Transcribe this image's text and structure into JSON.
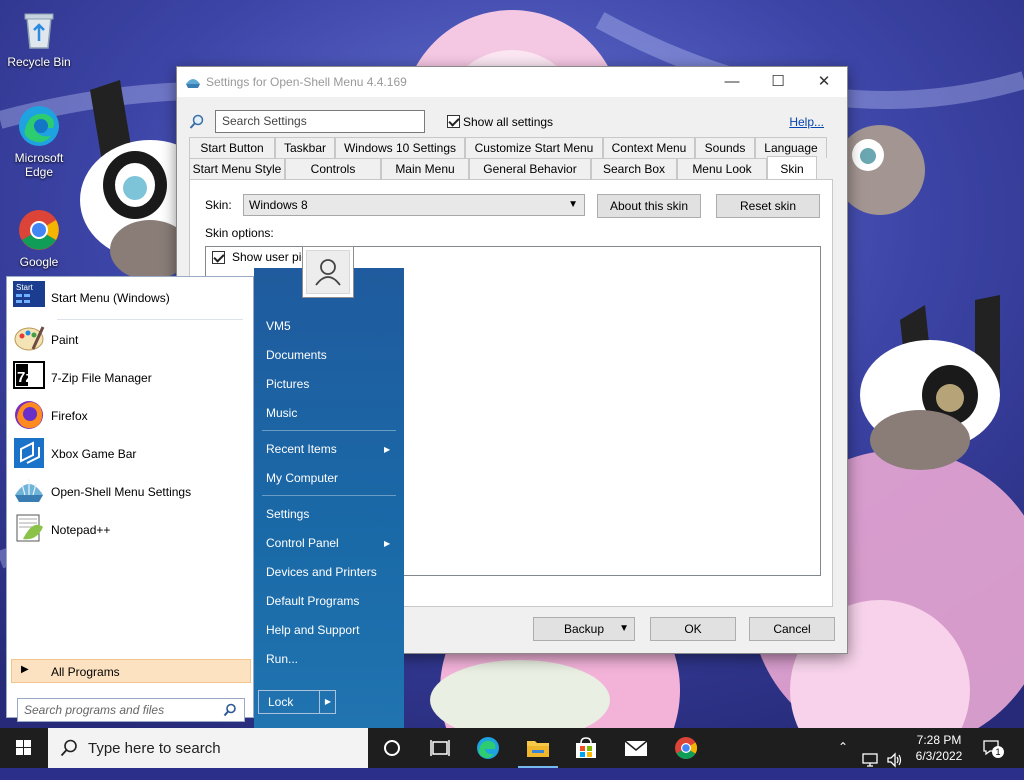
{
  "desktop": {
    "icons": [
      {
        "label": "Recycle Bin"
      },
      {
        "label": "Microsoft Edge"
      },
      {
        "label": "Google"
      }
    ]
  },
  "settings_window": {
    "title": "Settings for Open-Shell Menu 4.4.169",
    "search_placeholder": "Search Settings",
    "show_all_label": "Show all settings",
    "show_all_checked": true,
    "help_link": "Help...",
    "tabs_row1": [
      "Start Button",
      "Taskbar",
      "Windows 10 Settings",
      "Customize Start Menu",
      "Context Menu",
      "Sounds",
      "Language"
    ],
    "tabs_row2": [
      "Start Menu Style",
      "Controls",
      "Main Menu",
      "General Behavior",
      "Search Box",
      "Menu Look",
      "Skin"
    ],
    "active_tab": "Skin",
    "skin_label": "Skin:",
    "skin_value": "Windows 8",
    "about_skin_button": "About this skin",
    "reset_skin_button": "Reset skin",
    "skin_options_label": "Skin options:",
    "skin_option_1": "Show user pic",
    "backup_button": "Backup",
    "ok_button": "OK",
    "cancel_button": "Cancel"
  },
  "start_menu": {
    "pinned": [
      {
        "label": "Start Menu (Windows)",
        "icon": "start-menu-icon"
      },
      {
        "label": "Paint",
        "icon": "paint-icon"
      },
      {
        "label": "7-Zip File Manager",
        "icon": "7zip-icon"
      },
      {
        "label": "Firefox",
        "icon": "firefox-icon"
      },
      {
        "label": "Xbox Game Bar",
        "icon": "xbox-game-bar-icon"
      },
      {
        "label": "Open-Shell Menu Settings",
        "icon": "open-shell-icon"
      },
      {
        "label": "Notepad++",
        "icon": "notepadpp-icon"
      }
    ],
    "all_programs": "All Programs",
    "search_placeholder": "Search programs and files",
    "start_tile_text": "Start",
    "zip_tile_text": "7z",
    "right_items": [
      {
        "label": "VM5"
      },
      {
        "label": "Documents"
      },
      {
        "label": "Pictures"
      },
      {
        "label": "Music"
      },
      {
        "label": "Recent Items"
      },
      {
        "label": "My Computer"
      },
      {
        "label": "Settings"
      },
      {
        "label": "Control Panel"
      },
      {
        "label": "Devices and Printers"
      },
      {
        "label": "Default Programs"
      },
      {
        "label": "Help and Support"
      },
      {
        "label": "Run..."
      }
    ],
    "lock_button": "Lock"
  },
  "taskbar": {
    "search_placeholder": "Type here to search",
    "time": "7:28 PM",
    "date": "6/3/2022",
    "notification_count": "1",
    "apps": [
      "cortana-icon",
      "task-view-icon",
      "edge-icon",
      "file-explorer-icon",
      "store-icon",
      "mail-icon",
      "chrome-icon"
    ]
  },
  "colors": {
    "start_right_panel": "#1a6aa8",
    "all_programs_highlight": "#fde2c1",
    "taskbar": "#1e1e1e",
    "link": "#0645ad"
  }
}
